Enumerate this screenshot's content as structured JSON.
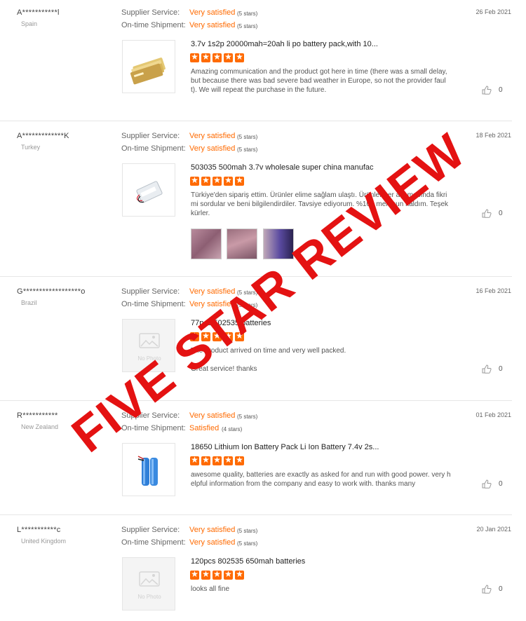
{
  "labels": {
    "supplier": "Supplier Service:",
    "shipment": "On-time Shipment:"
  },
  "reviews": [
    {
      "user": "A***********l",
      "country": "Spain",
      "date": "26 Feb 2021",
      "supplier_rating": "Very satisfied",
      "supplier_stars": "(5 stars)",
      "shipment_rating": "Very satisfied",
      "shipment_stars": "(5 stars)",
      "product": "3.7v 1s2p 20000mah=20ah li po battery pack,with 10...",
      "comment": "Amazing communication and the product got here in time (there was a small delay, but because there was bad severe bad weather in Europe, so not the provider fault). We will repeat the purchase in the future.",
      "likes": "0"
    },
    {
      "user": "A*************K",
      "country": "Turkey",
      "date": "18 Feb 2021",
      "supplier_rating": "Very satisfied",
      "supplier_stars": "(5 stars)",
      "shipment_rating": "Very satisfied",
      "shipment_stars": "(5 stars)",
      "product": "503035 500mah 3.7v wholesale super china manufac",
      "comment": "Türkiye'den sipariş ettim. Ürünler elime sağlam ulaştı. Ürünler her aşamasında fikrimi sordular ve beni bilgilendirdiler. Tavsiye ediyorum. %100 memnun kaldım. Teşekkürler.",
      "likes": "0"
    },
    {
      "user": "G******************o",
      "country": "Brazil",
      "date": "16 Feb 2021",
      "supplier_rating": "Very satisfied",
      "supplier_stars": "(5 stars)",
      "shipment_rating": "Very satisfied",
      "shipment_stars": "(5 stars)",
      "product": "77pcs 502535 batteries",
      "comment": "The product arrived on time and very well packed.",
      "comment2": "Great service! thanks",
      "no_photo": "No Photo",
      "likes": "0"
    },
    {
      "user": "R***********",
      "country": "New Zealand",
      "date": "01 Feb 2021",
      "supplier_rating": "Very satisfied",
      "supplier_stars": "(5 stars)",
      "shipment_rating": "Satisfied",
      "shipment_stars": "(4 stars)",
      "product": "18650 Lithium Ion Battery Pack Li Ion Battery 7.4v 2s...",
      "comment": "awesome quality, batteries are exactly as asked for and run with good power. very helpful information from the company and easy to work with. thanks many",
      "likes": "0"
    },
    {
      "user": "L***********c",
      "country": "United Kingdom",
      "date": "20 Jan 2021",
      "supplier_rating": "Very satisfied",
      "supplier_stars": "(5 stars)",
      "shipment_rating": "Very satisfied",
      "shipment_stars": "(5 stars)",
      "product": "120pcs 802535 650mah batteries",
      "comment": "looks all fine",
      "no_photo": "No Photo",
      "likes": "0"
    }
  ],
  "watermark": "FIVE STAR REVIEW",
  "colors": {
    "accent": "#ff6a00",
    "watermark": "#e41212"
  },
  "icons": {
    "stars": "star-icon",
    "like": "thumbs-up-icon",
    "no_photo": "image-placeholder-icon"
  }
}
